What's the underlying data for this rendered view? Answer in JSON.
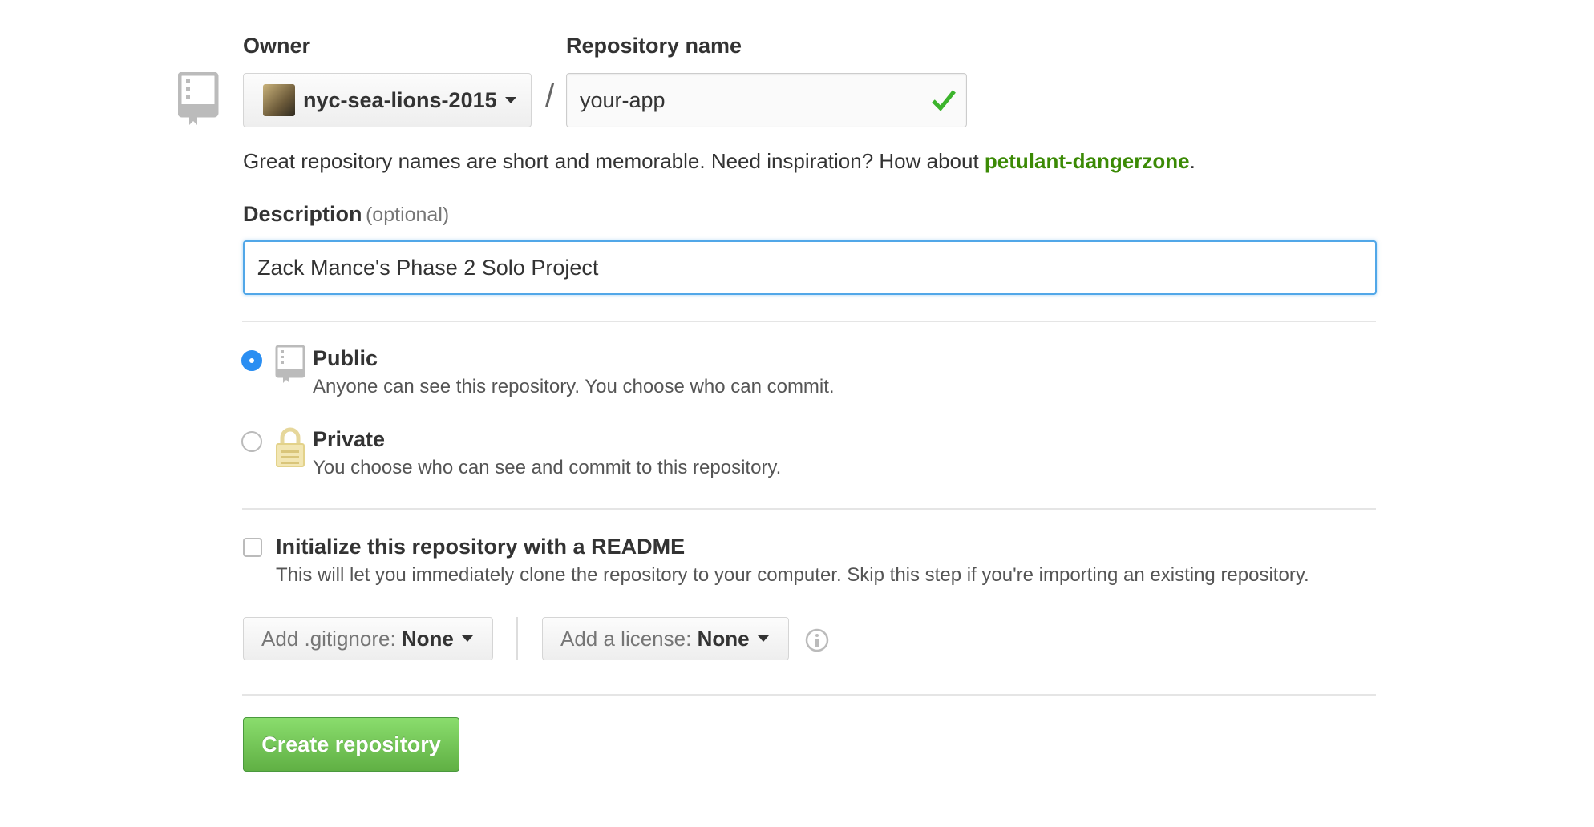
{
  "owner": {
    "label": "Owner",
    "value": "nyc-sea-lions-2015"
  },
  "slash": "/",
  "repo_name": {
    "label": "Repository name",
    "value": "your-app"
  },
  "suggestion": {
    "text": "Great repository names are short and memorable. Need inspiration? How about ",
    "name": "petulant-dangerzone",
    "end": "."
  },
  "description": {
    "label": "Description",
    "optional": "(optional)",
    "value": "Zack Mance's Phase 2 Solo Project"
  },
  "visibility": {
    "selected": "public",
    "public": {
      "title": "Public",
      "desc": "Anyone can see this repository. You choose who can commit."
    },
    "private": {
      "title": "Private",
      "desc": "You choose who can see and commit to this repository."
    }
  },
  "readme": {
    "checked": false,
    "title": "Initialize this repository with a README",
    "desc": "This will let you immediately clone the repository to your computer. Skip this step if you're importing an existing repository."
  },
  "gitignore": {
    "prefix": "Add .gitignore: ",
    "value": "None"
  },
  "license": {
    "prefix": "Add a license: ",
    "value": "None"
  },
  "create_button": "Create repository",
  "colors": {
    "accent_green": "#55a532",
    "suggestion_green": "#3b8a05",
    "focus_blue": "#51a7e8",
    "radio_blue": "#2a8ef2"
  }
}
